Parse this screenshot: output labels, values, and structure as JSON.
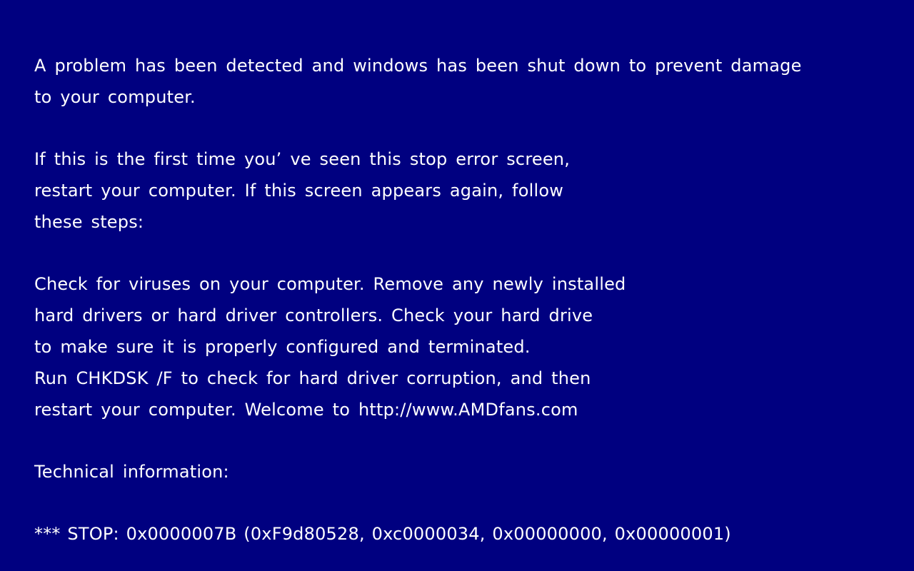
{
  "screen": {
    "background_color": "#000080",
    "text_color": "#ffffff",
    "intro": [
      "A problem has been detected and windows has been shut down to prevent damage",
      "to your computer."
    ],
    "first_time": [
      "If this is the first time you’ ve seen this stop error screen,",
      "restart your computer. If this screen appears again, follow",
      "these steps:"
    ],
    "steps": [
      "Check for viruses on your computer. Remove any newly installed",
      "hard drivers or hard driver controllers. Check your hard drive",
      "to make sure it is properly configured and terminated.",
      "Run CHKDSK /F to check for hard driver corruption, and then",
      "restart your computer. Welcome to http://www.AMDfans.com"
    ],
    "technical_heading": "Technical information:",
    "stop_code": "*** STOP: 0x0000007B (0xF9d80528, 0xc0000034, 0x00000000, 0x00000001)"
  }
}
